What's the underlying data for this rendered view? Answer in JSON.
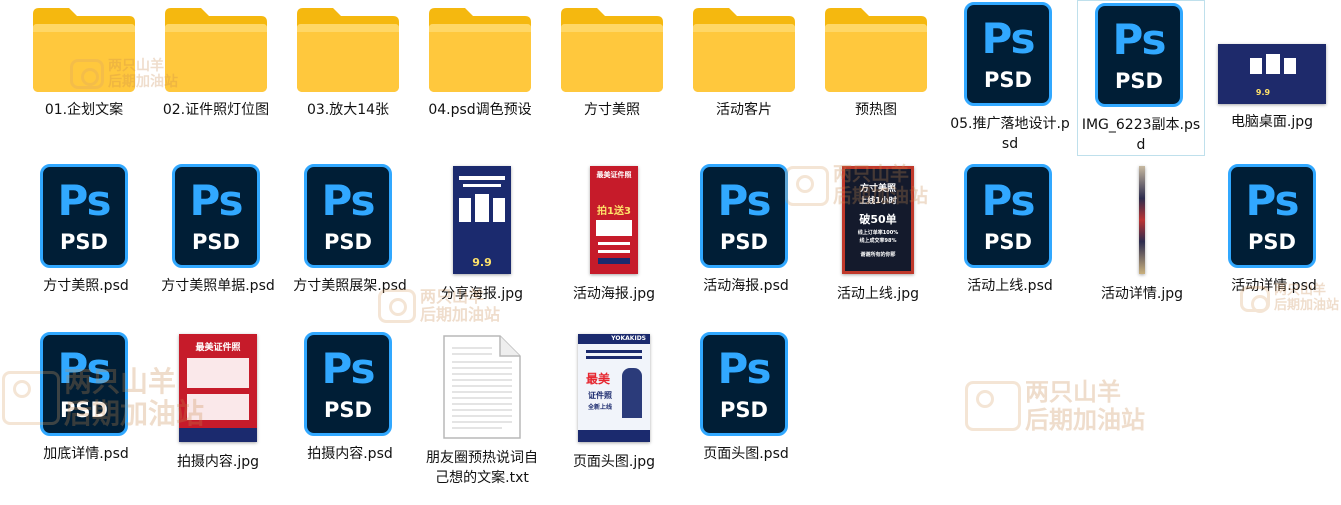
{
  "items": [
    {
      "id": "i01",
      "type": "folder",
      "label": "01.企划文案"
    },
    {
      "id": "i02",
      "type": "folder",
      "label": "02.证件照灯位图"
    },
    {
      "id": "i03",
      "type": "folder",
      "label": "03.放大14张"
    },
    {
      "id": "i04",
      "type": "folder",
      "label": "04.psd调色预设"
    },
    {
      "id": "i05",
      "type": "folder",
      "label": "方寸美照"
    },
    {
      "id": "i06",
      "type": "folder",
      "label": "活动客片"
    },
    {
      "id": "i07",
      "type": "folder",
      "label": "预热图"
    },
    {
      "id": "i08",
      "type": "psd",
      "label": "05.推广落地设计.psd"
    },
    {
      "id": "i09",
      "type": "psd",
      "label": "IMG_6223副本.psd"
    },
    {
      "id": "i10",
      "type": "jpg",
      "label": "电脑桌面.jpg"
    },
    {
      "id": "i11",
      "type": "psd",
      "label": "方寸美照.psd"
    },
    {
      "id": "i12",
      "type": "psd",
      "label": "方寸美照单据.psd"
    },
    {
      "id": "i13",
      "type": "psd",
      "label": "方寸美照展架.psd"
    },
    {
      "id": "i14",
      "type": "jpg",
      "label": "分享海报.jpg"
    },
    {
      "id": "i15",
      "type": "jpg",
      "label": "活动海报.jpg"
    },
    {
      "id": "i16",
      "type": "psd",
      "label": "活动海报.psd"
    },
    {
      "id": "i17",
      "type": "jpg",
      "label": "活动上线.jpg"
    },
    {
      "id": "i18",
      "type": "psd",
      "label": "活动上线.psd"
    },
    {
      "id": "i19",
      "type": "jpg",
      "label": "活动详情.jpg"
    },
    {
      "id": "i20",
      "type": "psd",
      "label": "活动详情.psd"
    },
    {
      "id": "i21",
      "type": "psd",
      "label": "加底详情.psd"
    },
    {
      "id": "i22",
      "type": "jpg",
      "label": "拍摄内容.jpg"
    },
    {
      "id": "i23",
      "type": "psd",
      "label": "拍摄内容.psd"
    },
    {
      "id": "i24",
      "type": "txt",
      "label": "朋友圈预热说词自己想的文案.txt"
    },
    {
      "id": "i25",
      "type": "jpg",
      "label": "页面头图.jpg"
    },
    {
      "id": "i26",
      "type": "psd",
      "label": "页面头图.psd"
    }
  ],
  "psd_icon": {
    "logo": "Ps",
    "ext": "PSD",
    "bg_color": "#001e36",
    "accent_color": "#31a8ff"
  },
  "thumbnails": {
    "share_poster": {
      "price": "9.9"
    },
    "event_poster": {
      "title": "最美证件照",
      "big": "拍1送3"
    },
    "launch": {
      "l1": "方寸美照",
      "l2": "上线1小时",
      "l3": "破50单",
      "l4": "线上订单率100%",
      "l5": "线上成交率98%",
      "l6": "谢谢所有的你那"
    },
    "shoot": {
      "title": "最美证件照"
    },
    "header": {
      "brand": "YOKAKIDS",
      "t1": "最美",
      "t2": "证件照",
      "t3": "全新上线"
    },
    "desktop": {
      "price": "9.9"
    }
  },
  "watermark": {
    "line1": "两只山羊",
    "line2": "后期加油站"
  },
  "colors": {
    "folder_body": "#ffc83d",
    "folder_back": "#f5b80f",
    "selection_border": "#bfe0ec"
  }
}
